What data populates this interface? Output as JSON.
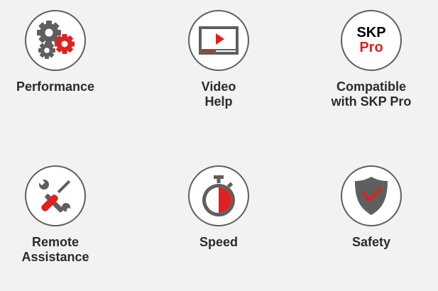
{
  "colors": {
    "accent": "#e0211e",
    "icon_gray": "#5f5f5f",
    "text": "#2b2b2b",
    "background": "#f2f2f2"
  },
  "features": [
    {
      "label": "Performance",
      "icon": "gears-icon"
    },
    {
      "label": "Video\nHelp",
      "icon": "video-player-icon"
    },
    {
      "label": "Compatible\nwith SKP Pro",
      "icon": "skp-pro-badge",
      "badge_line1": "SKP",
      "badge_line2": "Pro"
    },
    {
      "label": "Remote\nAssistance",
      "icon": "tools-icon"
    },
    {
      "label": "Speed",
      "icon": "stopwatch-icon"
    },
    {
      "label": "Safety",
      "icon": "shield-check-icon"
    }
  ]
}
